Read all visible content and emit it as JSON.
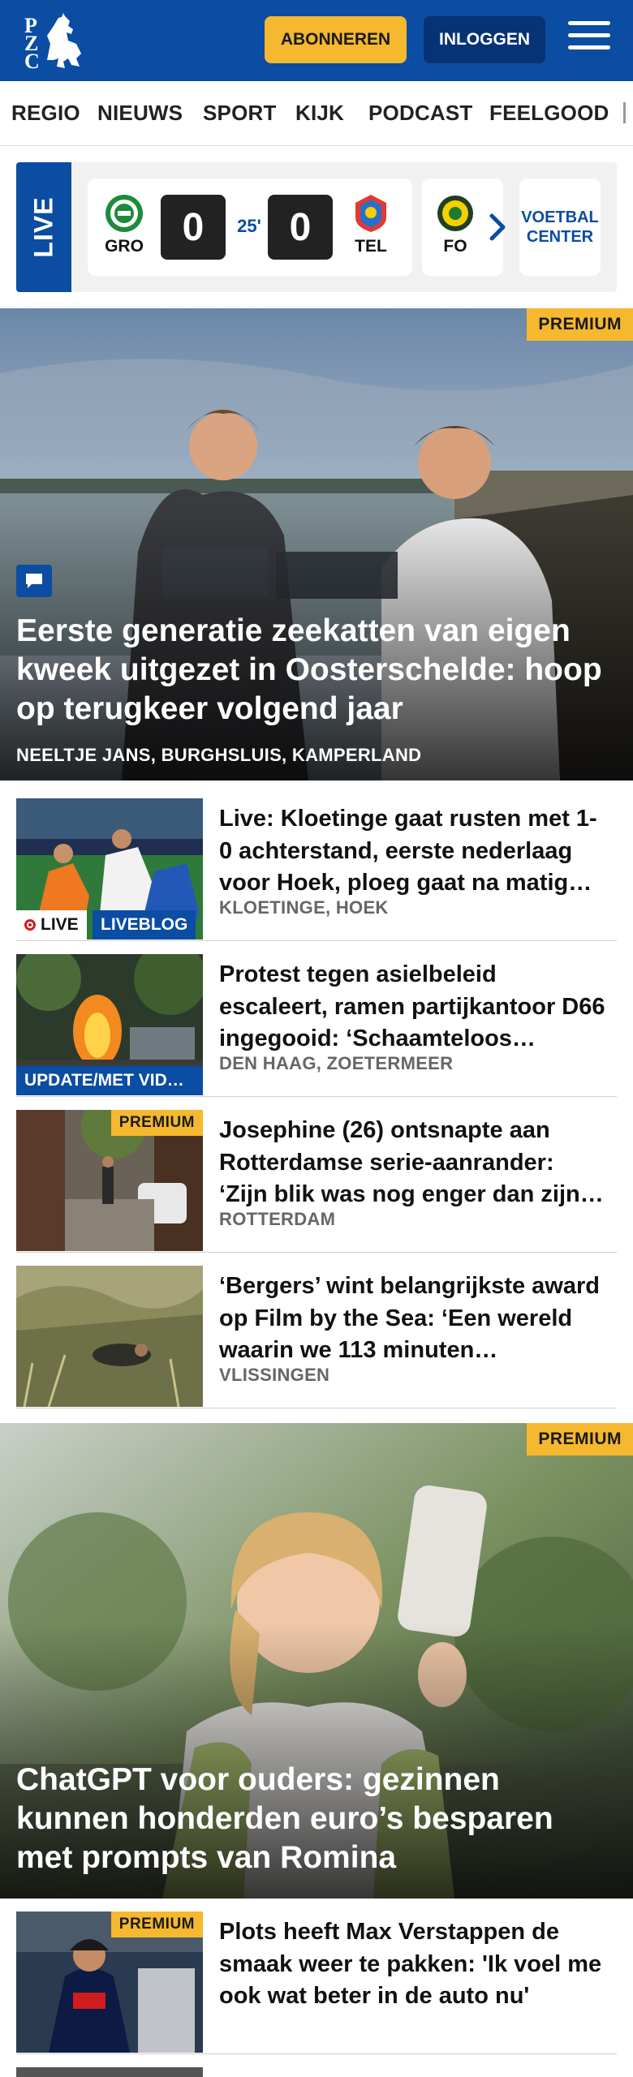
{
  "header": {
    "logo_letters": [
      "P",
      "Z",
      "C"
    ],
    "subscribe_label": "ABONNEREN",
    "login_label": "INLOGGEN",
    "menu_icon": "hamburger-icon",
    "colors": {
      "brand": "#0a4da2",
      "accent": "#f5b82e",
      "login_bg": "#063375"
    }
  },
  "nav": {
    "items": [
      {
        "label": "REGIO"
      },
      {
        "label": "NIEUWS"
      },
      {
        "label": "SPORT"
      },
      {
        "label": "KIJK"
      },
      {
        "label": "PODCAST"
      },
      {
        "label": "FEELGOOD"
      }
    ]
  },
  "live_strip": {
    "label": "LIVE",
    "match": {
      "home_code": "GRO",
      "home_score": "0",
      "minute": "25'",
      "away_score": "0",
      "away_code": "TEL"
    },
    "next_match": {
      "home_code": "FO"
    },
    "voetbal_center": "VOETBAL CENTER",
    "next_icon": "chevron-right-icon"
  },
  "hero1": {
    "badge": "PREMIUM",
    "title": "Eerste generatie zeekatten van eigen kweek uitgezet in Oosterschelde: hoop op terugkeer volgend jaar",
    "location": "NEELTJE JANS, BURGHSLUIS, KAMPERLAND",
    "comment_icon": "comment-icon"
  },
  "articles": [
    {
      "title": "Live: Kloetinge gaat rusten met 1-0 achterstand, eerste nederlaag voor Hoek, ploeg gaat na matig…",
      "location": "KLOETINGE, HOEK",
      "live_tag": "LIVE",
      "tag": "LIVEBLOG"
    },
    {
      "title": "Protest tegen asielbeleid escaleert, ramen partijkantoor D66 ingegooid: ‘Schaamteloos…",
      "location": "DEN HAAG, ZOETERMEER",
      "tag": "UPDATE/MET VID…"
    },
    {
      "title": "Josephine (26) ontsnapte aan Rotterdamse serie-aanrander: ‘Zijn blik was nog enger dan zijn…",
      "location": "ROTTERDAM",
      "badge": "PREMIUM"
    },
    {
      "title": "‘Bergers’ wint belangrijkste award op Film by the Sea: ‘Een wereld waarin we 113 minuten…",
      "location": "VLISSINGEN"
    }
  ],
  "hero2": {
    "badge": "PREMIUM",
    "title": "ChatGPT voor ouders: gezinnen kunnen honderden euro’s besparen met prompts van Romina"
  },
  "articles2": [
    {
      "title": "Plots heeft Max Verstappen de smaak weer te pakken: 'Ik voel me ook wat beter in de auto nu'",
      "badge": "PREMIUM"
    }
  ]
}
